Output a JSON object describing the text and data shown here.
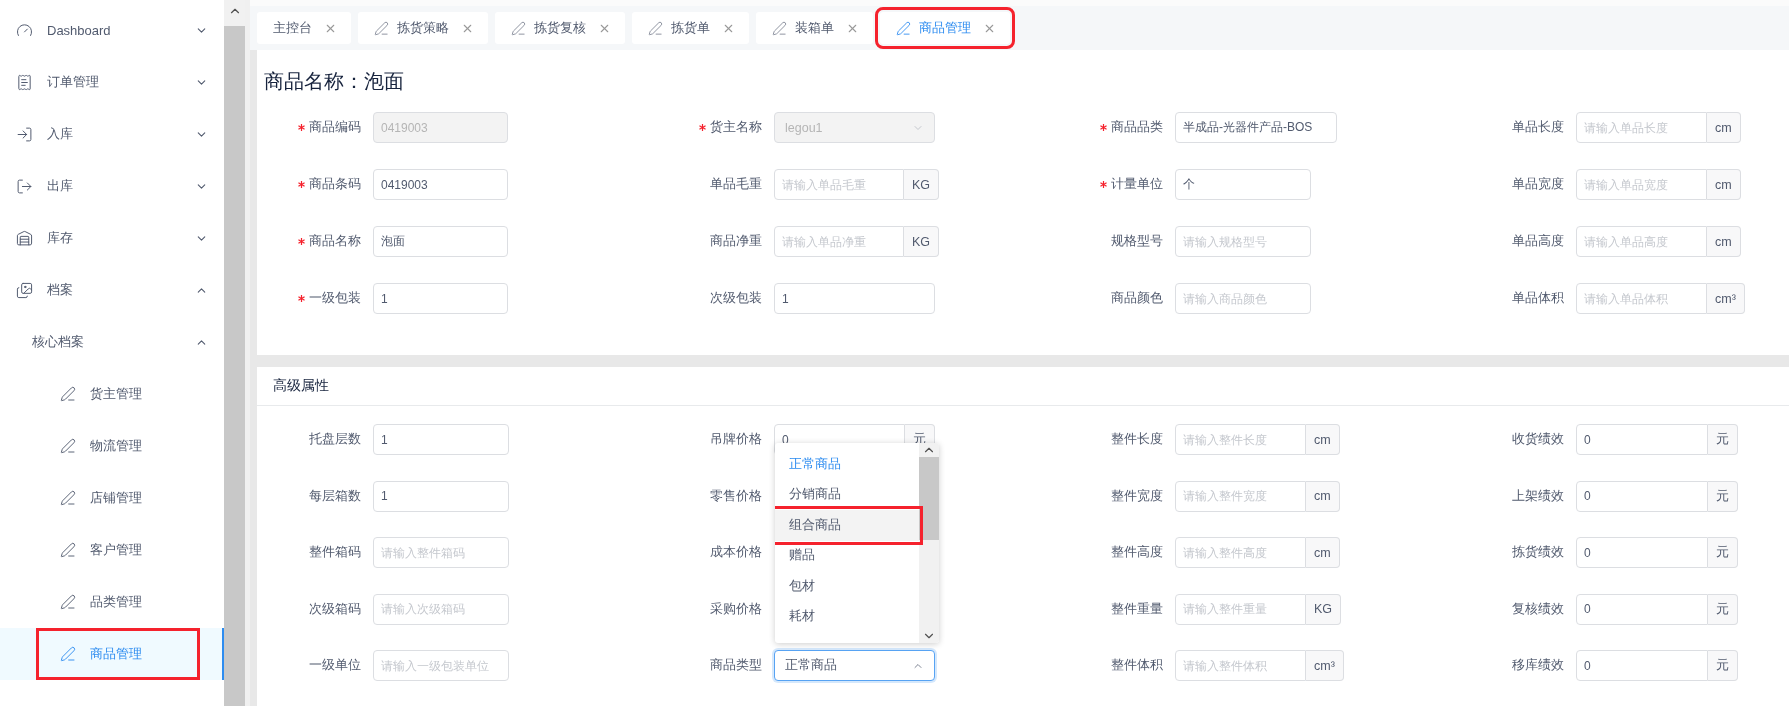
{
  "sidebar": {
    "items": [
      {
        "label": "Dashboard",
        "expanded": false
      },
      {
        "label": "订单管理",
        "expanded": false
      },
      {
        "label": "入库",
        "expanded": false
      },
      {
        "label": "出库",
        "expanded": false
      },
      {
        "label": "库存",
        "expanded": false
      },
      {
        "label": "档案",
        "expanded": true,
        "children": [
          {
            "label": "核心档案",
            "expanded": true,
            "children": [
              {
                "label": "货主管理",
                "selected": false,
                "annotated": false
              },
              {
                "label": "物流管理",
                "selected": false,
                "annotated": false
              },
              {
                "label": "店铺管理",
                "selected": false,
                "annotated": false
              },
              {
                "label": "客户管理",
                "selected": false,
                "annotated": false
              },
              {
                "label": "品类管理",
                "selected": false,
                "annotated": false
              },
              {
                "label": "商品管理",
                "selected": true,
                "annotated": true
              }
            ]
          }
        ]
      }
    ]
  },
  "tabs": [
    {
      "label": "主控台",
      "kind": "home",
      "selected": false,
      "annotated": false
    },
    {
      "label": "拣货策略",
      "kind": "page",
      "selected": false,
      "annotated": false
    },
    {
      "label": "拣货复核",
      "kind": "page",
      "selected": false,
      "annotated": false
    },
    {
      "label": "拣货单",
      "kind": "page",
      "selected": false,
      "annotated": false
    },
    {
      "label": "装箱单",
      "kind": "page",
      "selected": false,
      "annotated": false
    },
    {
      "label": "商品管理",
      "kind": "page",
      "selected": true,
      "annotated": true
    }
  ],
  "title": "商品名称：泡面",
  "basic": {
    "rows": [
      [
        {
          "label": "商品编码",
          "required": true,
          "kind": "text",
          "value": "0419003",
          "disabled": true
        },
        {
          "label": "货主名称",
          "required": true,
          "kind": "select",
          "value": "legou1",
          "disabled": true,
          "open": false
        },
        {
          "label": "商品品类",
          "required": true,
          "kind": "text",
          "value": "半成品-光器件产品-BOS",
          "disabled": false
        },
        {
          "label": "单品长度",
          "kind": "unit",
          "placeholder": "请输入单品长度",
          "unit": "cm"
        }
      ],
      [
        {
          "label": "商品条码",
          "required": true,
          "kind": "text",
          "value": "0419003",
          "disabled": false
        },
        {
          "label": "单品毛重",
          "kind": "unit",
          "placeholder": "请输入单品毛重",
          "unit": "KG"
        },
        {
          "label": "计量单位",
          "required": true,
          "kind": "text",
          "value": "个",
          "disabled": false
        },
        {
          "label": "单品宽度",
          "kind": "unit",
          "placeholder": "请输入单品宽度",
          "unit": "cm"
        }
      ],
      [
        {
          "label": "商品名称",
          "required": true,
          "kind": "text",
          "value": "泡面",
          "disabled": false
        },
        {
          "label": "商品净重",
          "kind": "unit",
          "placeholder": "请输入单品净重",
          "unit": "KG"
        },
        {
          "label": "规格型号",
          "kind": "text",
          "placeholder": "请输入规格型号",
          "disabled": false
        },
        {
          "label": "单品高度",
          "kind": "unit",
          "placeholder": "请输入单品高度",
          "unit": "cm"
        }
      ],
      [
        {
          "label": "一级包装",
          "required": true,
          "kind": "text",
          "value": "1",
          "disabled": false
        },
        {
          "label": "次级包装",
          "kind": "text",
          "value": "1",
          "disabled": false
        },
        {
          "label": "商品颜色",
          "kind": "text",
          "placeholder": "请输入商品颜色",
          "disabled": false
        },
        {
          "label": "单品体积",
          "kind": "unit",
          "placeholder": "请输入单品体积",
          "unit": "cm³"
        }
      ]
    ]
  },
  "advanced": {
    "title": "高级属性",
    "rows": [
      [
        {
          "label": "托盘层数",
          "kind": "text",
          "value": "1",
          "disabled": false
        },
        {
          "label": "吊牌价格",
          "kind": "unit",
          "value": "0",
          "unit": "元"
        },
        {
          "label": "整件长度",
          "kind": "unit",
          "placeholder": "请输入整件长度",
          "unit": "cm"
        },
        {
          "label": "收货绩效",
          "kind": "unit",
          "value": "0",
          "unit": "元"
        }
      ],
      [
        {
          "label": "每层箱数",
          "kind": "text",
          "value": "1",
          "disabled": false
        },
        {
          "label": "零售价格",
          "kind": "covered"
        },
        {
          "label": "整件宽度",
          "kind": "unit",
          "placeholder": "请输入整件宽度",
          "unit": "cm"
        },
        {
          "label": "上架绩效",
          "kind": "unit",
          "value": "0",
          "unit": "元"
        }
      ],
      [
        {
          "label": "整件箱码",
          "kind": "text",
          "placeholder": "请输入整件箱码",
          "disabled": false
        },
        {
          "label": "成本价格",
          "kind": "covered"
        },
        {
          "label": "整件高度",
          "kind": "unit",
          "placeholder": "请输入整件高度",
          "unit": "cm"
        },
        {
          "label": "拣货绩效",
          "kind": "unit",
          "value": "0",
          "unit": "元"
        }
      ],
      [
        {
          "label": "次级箱码",
          "kind": "text",
          "placeholder": "请输入次级箱码",
          "disabled": false
        },
        {
          "label": "采购价格",
          "kind": "covered"
        },
        {
          "label": "整件重量",
          "kind": "unit",
          "placeholder": "请输入整件重量",
          "unit": "KG"
        },
        {
          "label": "复核绩效",
          "kind": "unit",
          "value": "0",
          "unit": "元"
        }
      ],
      [
        {
          "label": "一级单位",
          "kind": "text",
          "placeholder": "请输入一级包装单位",
          "disabled": false
        },
        {
          "label": "商品类型",
          "kind": "select",
          "value": "正常商品",
          "disabled": false,
          "open": true
        },
        {
          "label": "整件体积",
          "kind": "unit",
          "placeholder": "请输入整件体积",
          "unit": "cm³"
        },
        {
          "label": "移库绩效",
          "kind": "unit",
          "value": "0",
          "unit": "元"
        }
      ]
    ]
  },
  "dropdown": {
    "options": [
      {
        "label": "正常商品",
        "selected": true,
        "hovered": false,
        "annotated": false
      },
      {
        "label": "分销商品",
        "selected": false,
        "hovered": false,
        "annotated": false
      },
      {
        "label": "组合商品",
        "selected": false,
        "hovered": true,
        "annotated": true
      },
      {
        "label": "赠品",
        "selected": false,
        "hovered": false,
        "annotated": false
      },
      {
        "label": "包材",
        "selected": false,
        "hovered": false,
        "annotated": false
      },
      {
        "label": "耗材",
        "selected": false,
        "hovered": false,
        "annotated": false
      }
    ]
  }
}
